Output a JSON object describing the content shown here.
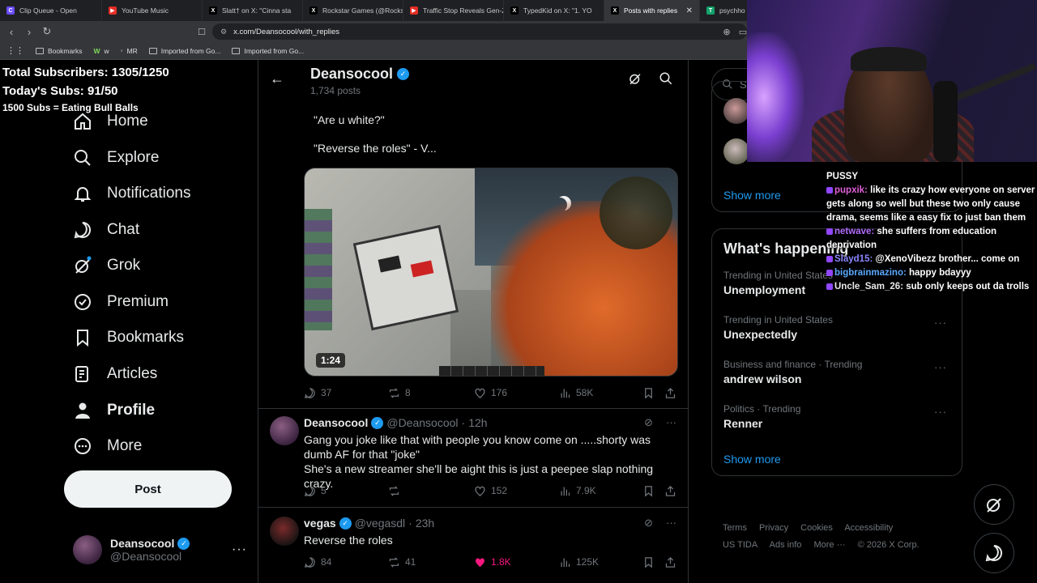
{
  "browser": {
    "tabs": [
      {
        "label": "Clip Queue - Open",
        "color": "#6a4cff",
        "glyph": "C"
      },
      {
        "label": "YouTube Music",
        "color": "#e52d27",
        "glyph": "▶"
      },
      {
        "label": "Slatt† on X: \"Cinna sta",
        "color": "#000000",
        "glyph": "X"
      },
      {
        "label": "Rockstar Games (@Rocks",
        "color": "#000000",
        "glyph": "X"
      },
      {
        "label": "Traffic Stop Reveals Gen-Z",
        "color": "#e52d27",
        "glyph": "▶"
      },
      {
        "label": "TypedKid on X: \"1. YO",
        "color": "#000000",
        "glyph": "X"
      },
      {
        "label": "Posts with replies",
        "color": "#000000",
        "glyph": "X"
      },
      {
        "label": "psychho",
        "color": "#12a36b",
        "glyph": "T"
      }
    ],
    "url": "x.com/Deansocool/with_replies",
    "bookmarks": [
      "Bookmarks",
      "w",
      "MR",
      "Imported from Go...",
      "Imported from Go..."
    ]
  },
  "overlay": {
    "total_subs": "Total Subscribers: 1305/1250",
    "today_subs": "Today's Subs: 91/50",
    "goal": "1500 Subs = Eating Bull Balls"
  },
  "nav": {
    "items": [
      "Home",
      "Explore",
      "Notifications",
      "Chat",
      "Grok",
      "Premium",
      "Bookmarks",
      "Articles",
      "Profile",
      "More"
    ],
    "post_label": "Post",
    "account_name": "Deansocool",
    "account_handle": "@Deansocool"
  },
  "header": {
    "name": "Deansocool",
    "posts": "1,734 posts"
  },
  "tweet1": {
    "line1": "\"Are u white?\"",
    "line2": "\"Reverse the roles\" - V...",
    "video_time": "1:24",
    "replies": "37",
    "reposts": "8",
    "likes": "176",
    "views": "58K"
  },
  "tweet2": {
    "name": "Deansocool",
    "handle": "@Deansocool",
    "time": "12h",
    "line1": "Gang you joke like that with people you know come on .....shorty was dumb AF for that \"joke\"",
    "line2": "She's a new streamer she'll be aight this is just a peepee slap nothing crazy.",
    "replies": "5",
    "likes": "152",
    "views": "7.9K"
  },
  "tweet3": {
    "name": "vegas",
    "handle": "@vegasdl",
    "time": "23h",
    "text": "Reverse the roles",
    "replies": "84",
    "reposts": "41",
    "likes": "1.8K",
    "views": "125K"
  },
  "right": {
    "search_placeholder": "Se",
    "show_more": "Show more",
    "happening_title": "What's happening",
    "trends": [
      {
        "meta": "Trending in United States",
        "title": "Unemployment"
      },
      {
        "meta": "Trending in United States",
        "title": "Unexpectedly"
      },
      {
        "meta": "Business and finance · Trending",
        "title": "andrew wilson"
      },
      {
        "meta": "Politics · Trending",
        "title": "Renner"
      }
    ],
    "footer": [
      "Terms",
      "Privacy",
      "Cookies",
      "Accessibility",
      "US TIDA",
      "Ads info",
      "More ···",
      "© 2026 X Corp."
    ]
  },
  "chat": [
    {
      "user": "",
      "text": "PUSSY"
    },
    {
      "user": "pupxik:",
      "text": " like its crazy how everyone on server gets along so well but these two only cause drama, seems like a easy fix to just ban them"
    },
    {
      "user": "netwave:",
      "text": " she suffers from education deprivation"
    },
    {
      "user": "Slayd15:",
      "text": " @XenoVibezz brother... come on"
    },
    {
      "user": "bigbrainmazino:",
      "text": " happy bdayyy"
    },
    {
      "user": "Uncle_Sam_26:",
      "text": " sub only keeps out da trolls"
    }
  ],
  "colors": {
    "accent": "#1d9bf0",
    "like_active": "#f91880",
    "muted": "#71767b"
  }
}
